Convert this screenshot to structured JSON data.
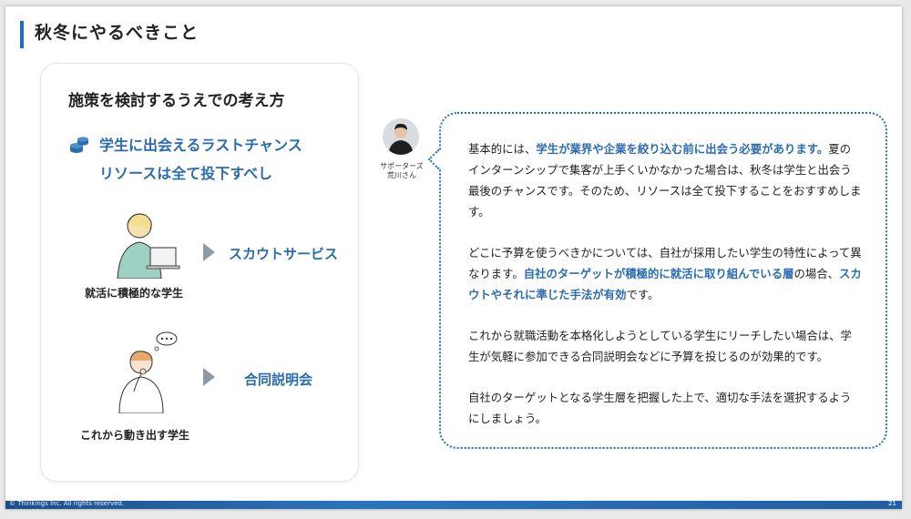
{
  "slide": {
    "title": "秋冬にやるべきこと",
    "footer_copyright": "© Thinkings Inc. All rights reserved.",
    "page_number": "21"
  },
  "card": {
    "title": "施策を検討するうえでの考え方",
    "subtitle_line1": "学生に出会えるラストチャンス",
    "subtitle_line2": "リソースは全て投下すべし",
    "rows": [
      {
        "caption": "就活に積極的な学生",
        "service": "スカウトサービス"
      },
      {
        "caption": "これから動き出す学生",
        "service": "合同説明会"
      }
    ]
  },
  "advisor": {
    "role": "サポーターズ",
    "name": "荒川さん"
  },
  "bubble": {
    "p1_a": "基本的には、",
    "p1_hl": "学生が業界や企業を絞り込む前に出会う必要があります。",
    "p1_b": "夏のインターンシップで集客が上手くいかなかった場合は、秋冬は学生と出会う最後のチャンスです。そのため、リソースは全て投下することをおすすめします。",
    "p2_a": "どこに予算を使うべきかについては、自社が採用したい学生の特性によって異なります。",
    "p2_hl": "自社のターゲットが積極的に就活に取り組んでいる層",
    "p2_b": "の場合、",
    "p2_hl2": "スカウトやそれに準じた手法が有効",
    "p2_c": "です。",
    "p3": "これから就職活動を本格化しようとしている学生にリーチしたい場合は、学生が気軽に参加できる合同説明会などに予算を投じるのが効果的です。",
    "p4": "自社のターゲットとなる学生層を把握した上で、適切な手法を選択するようにしましょう。"
  },
  "colors": {
    "accent": "#2b6cb0",
    "title_bar": "#1f6fb8",
    "arrow": "#8e9aa8"
  },
  "icons": [
    "coins-icon",
    "student-laptop-illustration",
    "thinking-student-illustration",
    "advisor-avatar",
    "arrow-right-icon"
  ]
}
